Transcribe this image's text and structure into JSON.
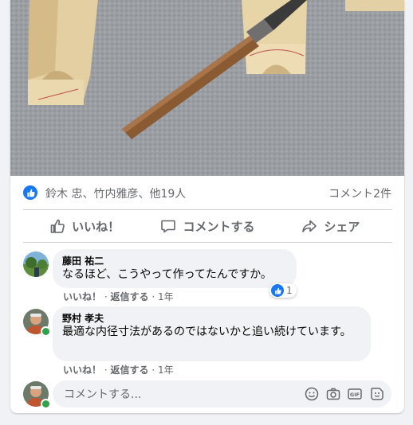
{
  "post": {
    "reactors": "鈴木 忠、竹内雅彦、他19人",
    "comment_count": "コメント2件"
  },
  "actions": {
    "like": "いいね！",
    "comment": "コメントする",
    "share": "シェア"
  },
  "comments": [
    {
      "author": "藤田 祐二",
      "text": "なるほど、こうやって作ってたんですか。",
      "like_label": "いいね！",
      "reply_label": "返信する",
      "time": "1年",
      "reaction_count": "1"
    },
    {
      "author": "野村 孝夫",
      "text": "最適な内径寸法があるのではないかと追い続けています。",
      "like_label": "いいね！",
      "reply_label": "返信する",
      "time": "1年"
    }
  ],
  "composer": {
    "placeholder": "コメントする..."
  },
  "colors": {
    "accent": "#1877f2",
    "online": "#31a24c",
    "secondary_text": "#65676b"
  },
  "icons": [
    "like-icon",
    "comment-icon",
    "share-icon",
    "emoji-icon",
    "camera-icon",
    "gif-icon",
    "sticker-icon"
  ]
}
